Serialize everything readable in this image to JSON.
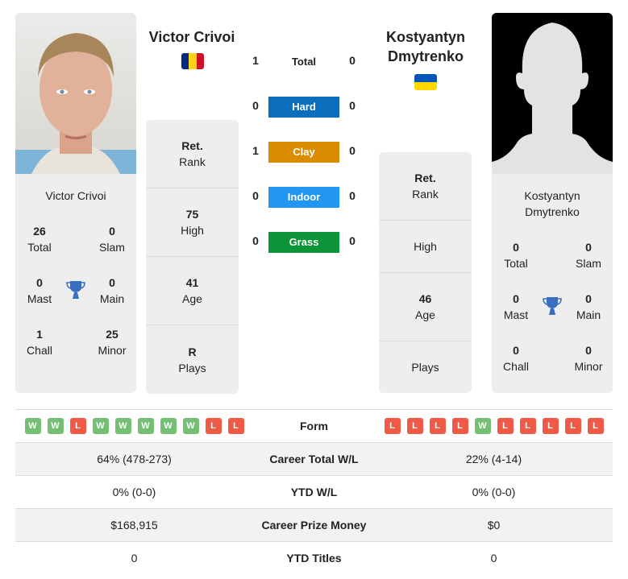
{
  "player1": {
    "name": "Victor Crivoi",
    "country": "Romania",
    "flag_colors": [
      "#002B7F",
      "#FCD116",
      "#CE1126"
    ],
    "titles": {
      "total": {
        "value": "26",
        "label": "Total"
      },
      "slam": {
        "value": "0",
        "label": "Slam"
      },
      "mast": {
        "value": "0",
        "label": "Mast"
      },
      "main": {
        "value": "0",
        "label": "Main"
      },
      "chall": {
        "value": "1",
        "label": "Chall"
      },
      "minor": {
        "value": "25",
        "label": "Minor"
      }
    },
    "info": {
      "rank": {
        "value": "Ret.",
        "label": "Rank"
      },
      "high": {
        "value": "75",
        "label": "High"
      },
      "age": {
        "value": "41",
        "label": "Age"
      },
      "plays": {
        "value": "R",
        "label": "Plays"
      }
    },
    "form": [
      "W",
      "W",
      "L",
      "W",
      "W",
      "W",
      "W",
      "W",
      "L",
      "L"
    ]
  },
  "player2": {
    "name": "Kostyantyn Dmytrenko",
    "name_line1": "Kostyantyn",
    "name_line2": "Dmytrenko",
    "country": "Ukraine",
    "flag_colors": [
      "#0057B7",
      "#FFD700"
    ],
    "titles": {
      "total": {
        "value": "0",
        "label": "Total"
      },
      "slam": {
        "value": "0",
        "label": "Slam"
      },
      "mast": {
        "value": "0",
        "label": "Mast"
      },
      "main": {
        "value": "0",
        "label": "Main"
      },
      "chall": {
        "value": "0",
        "label": "Chall"
      },
      "minor": {
        "value": "0",
        "label": "Minor"
      }
    },
    "info": {
      "rank": {
        "value": "Ret.",
        "label": "Rank"
      },
      "high": {
        "value": "",
        "label": "High"
      },
      "age": {
        "value": "46",
        "label": "Age"
      },
      "plays": {
        "value": "",
        "label": "Plays"
      }
    },
    "form": [
      "L",
      "L",
      "L",
      "L",
      "W",
      "L",
      "L",
      "L",
      "L",
      "L"
    ]
  },
  "h2h": {
    "total": {
      "label": "Total",
      "p1": "1",
      "p2": "0"
    },
    "surfaces": [
      {
        "label": "Hard",
        "p1": "0",
        "p2": "0",
        "color": "#0a6ebd"
      },
      {
        "label": "Clay",
        "p1": "1",
        "p2": "0",
        "color": "#dc8c00"
      },
      {
        "label": "Indoor",
        "p1": "0",
        "p2": "0",
        "color": "#2196f3"
      },
      {
        "label": "Grass",
        "p1": "0",
        "p2": "0",
        "color": "#0c9438"
      }
    ]
  },
  "comparison": {
    "form_label": "Form",
    "rows": [
      {
        "label": "Career Total W/L",
        "p1": "64% (478-273)",
        "p2": "22% (4-14)"
      },
      {
        "label": "YTD W/L",
        "p1": "0% (0-0)",
        "p2": "0% (0-0)"
      },
      {
        "label": "Career Prize Money",
        "p1": "$168,915",
        "p2": "$0"
      },
      {
        "label": "YTD Titles",
        "p1": "0",
        "p2": "0"
      }
    ]
  }
}
